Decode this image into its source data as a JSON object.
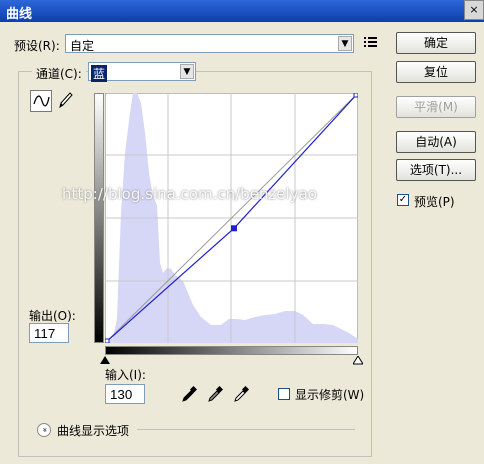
{
  "window": {
    "title": "曲线",
    "close_glyph": "×"
  },
  "preset": {
    "label": "预设(R):",
    "value": "自定",
    "menu_icon": "options-menu-icon"
  },
  "channel": {
    "label": "通道(C):",
    "value": "蓝"
  },
  "buttons": {
    "ok": "确定",
    "reset": "复位",
    "smooth": "平滑(M)",
    "auto": "自动(A)",
    "options": "选项(T)..."
  },
  "preview": {
    "label": "预览(P)",
    "checked": true,
    "mark": "✓"
  },
  "output": {
    "label": "输出(O):",
    "value": "117"
  },
  "input": {
    "label": "输入(I):",
    "value": "130"
  },
  "show_clipping": {
    "label": "显示修剪(W)",
    "checked": false
  },
  "display_options": {
    "label": "曲线显示选项",
    "expand_glyph": "»"
  },
  "watermark": "http://blog.sina.com.cn/benzelyao",
  "colors": {
    "curve": "#1f1fd0",
    "histogram": "#d6d6f6",
    "title_bar": "#0b3fae"
  },
  "curve": {
    "points": [
      [
        0,
        0
      ],
      [
        130,
        117
      ],
      [
        255,
        255
      ]
    ]
  }
}
